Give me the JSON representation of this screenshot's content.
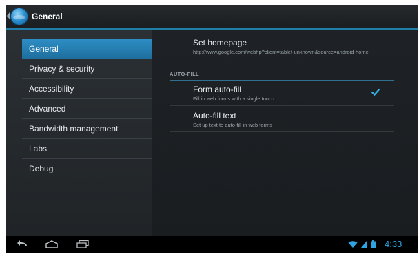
{
  "action_bar": {
    "title": "General",
    "icon": "browser-app-icon"
  },
  "headers": [
    {
      "label": "General",
      "selected": true
    },
    {
      "label": "Privacy & security",
      "selected": false
    },
    {
      "label": "Accessibility",
      "selected": false
    },
    {
      "label": "Advanced",
      "selected": false
    },
    {
      "label": "Bandwidth management",
      "selected": false
    },
    {
      "label": "Labs",
      "selected": false
    },
    {
      "label": "Debug",
      "selected": false
    }
  ],
  "settings": {
    "homepage": {
      "title": "Set homepage",
      "summary": "http://www.google.com/webhp?client=tablet-unknown&source=android-home"
    },
    "autofill_category": "AUTO-FILL",
    "form_autofill": {
      "title": "Form auto-fill",
      "summary": "Fill in web forms with a single touch",
      "checked": true
    },
    "autofill_text": {
      "title": "Auto-fill text",
      "summary": "Set up text to auto-fill in web forms"
    }
  },
  "nav_bar": {
    "buttons": [
      "back-icon",
      "home-icon",
      "recent-apps-icon"
    ]
  },
  "status": {
    "time": "4:33",
    "icons": [
      "wifi-icon",
      "signal-icon",
      "battery-icon"
    ],
    "accent_color": "#2fa3e0"
  }
}
